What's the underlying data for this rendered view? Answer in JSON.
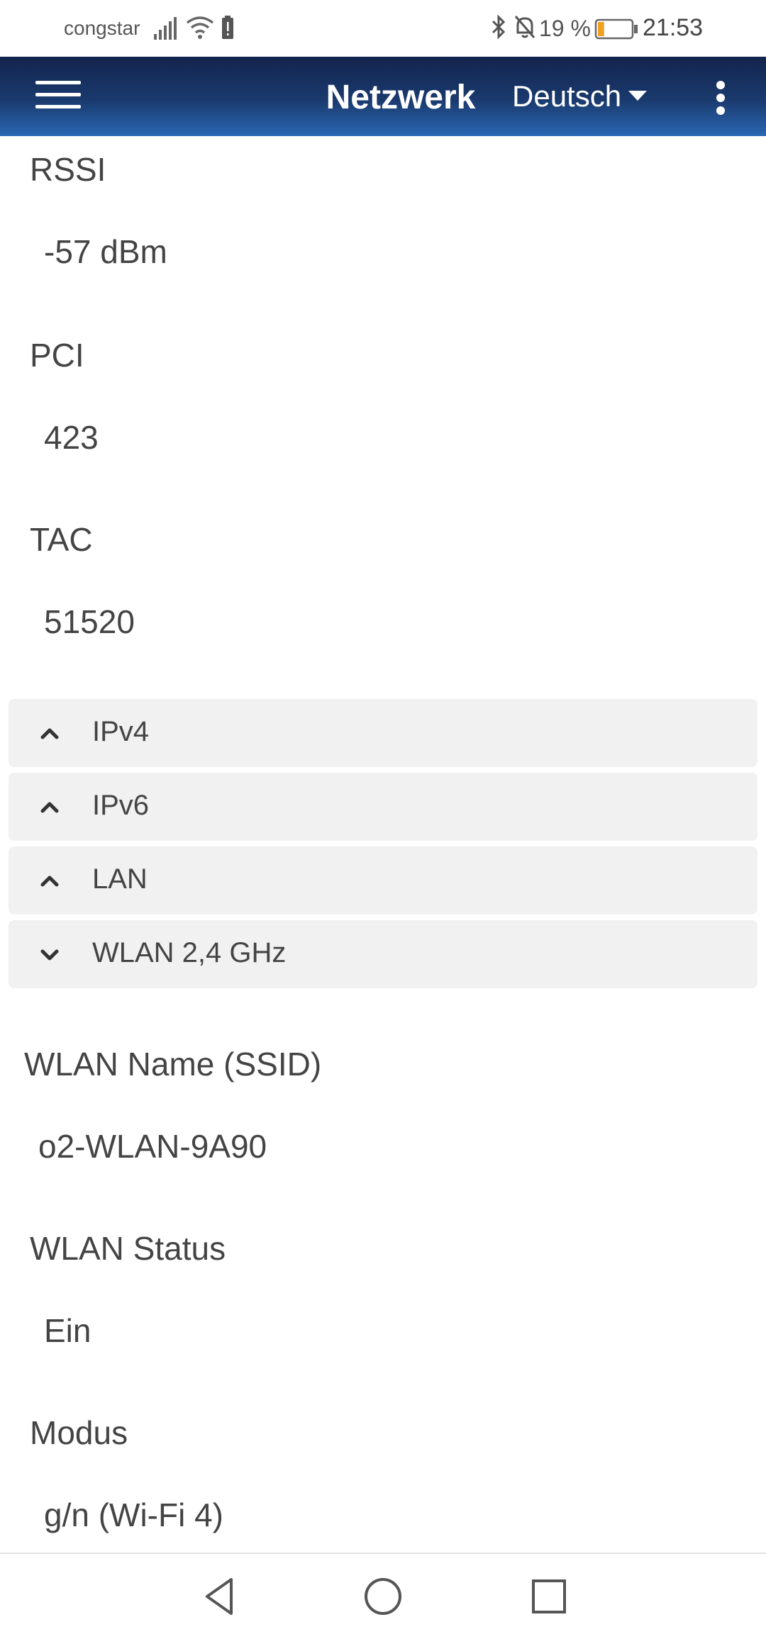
{
  "status_bar": {
    "carrier": "congstar",
    "battery_percent": "19 %",
    "battery_level": 0.19,
    "time": "21:53",
    "icons": [
      "signal-icon",
      "wifi-icon",
      "battery-alert-icon",
      "bluetooth-icon",
      "bell-off-icon",
      "battery-icon"
    ]
  },
  "header": {
    "menu_icon": "hamburger-menu-icon",
    "title": "Netzwerk",
    "language": "Deutsch",
    "more_icon": "more-vertical-icon"
  },
  "fields_top": [
    {
      "label": "RSSI",
      "value": "-57 dBm"
    },
    {
      "label": "PCI",
      "value": "423"
    },
    {
      "label": "TAC",
      "value": "51520"
    }
  ],
  "accordions": [
    {
      "label": "IPv4",
      "state": "collapsed",
      "icon": "chevron-up-icon"
    },
    {
      "label": "IPv6",
      "state": "collapsed",
      "icon": "chevron-up-icon"
    },
    {
      "label": "LAN",
      "state": "collapsed",
      "icon": "chevron-up-icon"
    },
    {
      "label": "WLAN 2,4 GHz",
      "state": "expanded",
      "icon": "chevron-down-icon"
    }
  ],
  "wlan_fields": [
    {
      "label": "WLAN Name (SSID)",
      "value": "o2-WLAN-9A90"
    },
    {
      "label": "WLAN Status",
      "value": "Ein"
    },
    {
      "label": "Modus",
      "value": "g/n (Wi-Fi 4)"
    }
  ],
  "nav_bar": {
    "icons": [
      "back-icon",
      "home-icon",
      "recents-icon"
    ]
  }
}
